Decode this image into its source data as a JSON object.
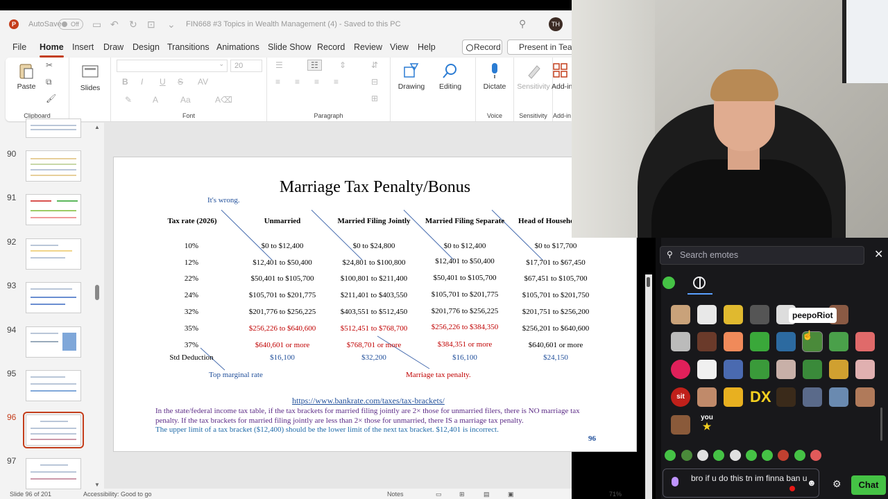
{
  "titlebar": {
    "autosave_label": "AutoSave",
    "autosave_state": "Off",
    "document_title": "FIN668 #3 Topics in Wealth Management (4)  -  Saved to this PC",
    "avatar_initials": "TH"
  },
  "tabs": [
    "File",
    "Home",
    "Insert",
    "Draw",
    "Design",
    "Transitions",
    "Animations",
    "Slide Show",
    "Record",
    "Review",
    "View",
    "Help"
  ],
  "active_tab": "Home",
  "record_button": "Record",
  "present_button": "Present in Teams",
  "ribbon": {
    "paste": "Paste",
    "slides": "Slides",
    "font_size": "20",
    "drawing": "Drawing",
    "editing": "Editing",
    "dictate": "Dictate",
    "sensitivity_btn": "Sensitivity",
    "addins": "Add-ins",
    "groups": {
      "clipboard": "Clipboard",
      "font": "Font",
      "paragraph": "Paragraph",
      "voice": "Voice",
      "sensitivity": "Sensitivity",
      "addins": "Add-in"
    }
  },
  "slide_numbers": [
    "90",
    "91",
    "92",
    "93",
    "94",
    "95",
    "96",
    "97"
  ],
  "selected_slide": "96",
  "slide": {
    "title": "Marriage Tax Penalty/Bonus",
    "note_wrong": "It's wrong.",
    "headers": [
      "Tax rate (2026)",
      "Unmarried",
      "Married Filing Jointly",
      "Married Filing Separate",
      "Head of Household"
    ],
    "rows": [
      [
        "10%",
        "$0 to $12,400",
        "$0 to $24,800",
        "$0 to $12,400",
        "$0 to $17,700"
      ],
      [
        "12%",
        "$12,401 to $50,400",
        "$24,801 to $100,800",
        "$12,401 to $50,400",
        "$17,701 to $67,450"
      ],
      [
        "22%",
        "$50,401 to $105,700",
        "$100,801 to $211,400",
        "$50,401 to $105,700",
        "$67,451 to $105,700"
      ],
      [
        "24%",
        "$105,701 to $201,775",
        "$211,401 to $403,550",
        "$105,701 to $201,775",
        "$105,701 to $201,750"
      ],
      [
        "32%",
        "$201,776 to $256,225",
        "$403,551 to $512,450",
        "$201,776 to $256,225",
        "$201,751 to $256,200"
      ],
      [
        "35%",
        "$256,226 to $640,600",
        "$512,451 to $768,700",
        "$256,226 to $384,350",
        "$256,201 to $640,600"
      ],
      [
        "37%",
        "$640,601 or more",
        "$768,701 or more",
        "$384,351 or more",
        "$640,601 or more"
      ]
    ],
    "std_row": [
      "Std Deduction",
      "$16,100",
      "$32,200",
      "$16,100",
      "$24,150"
    ],
    "note_marginal": "Top marginal rate",
    "note_penalty": "Marriage tax penalty.",
    "link": "https://www.bankrate.com/taxes/tax-brackets/",
    "para1": "In the state/federal income tax table, if the tax brackets for married filing jointly are 2× those for unmarried filers, there is NO marriage tax penalty. If the tax brackets for married filing jointly are less than 2× those for unmarried, there IS a marriage tax penalty.",
    "para2": "The upper limit of a tax bracket ($12,400) should be the lower limit of the next tax bracket. $12,401 is incorrect.",
    "page_number": "96"
  },
  "status": {
    "slide_info": "Slide 96 of 201",
    "accessibility": "Accessibility: Good to go",
    "notes": "Notes",
    "zoom": "71%"
  },
  "emotes": {
    "search_placeholder": "Search emotes",
    "tooltip": "peepoRiot",
    "you_label": "you"
  },
  "chat": {
    "input_text": "bro if u do this tn im finna ban u",
    "send_label": "Chat"
  }
}
